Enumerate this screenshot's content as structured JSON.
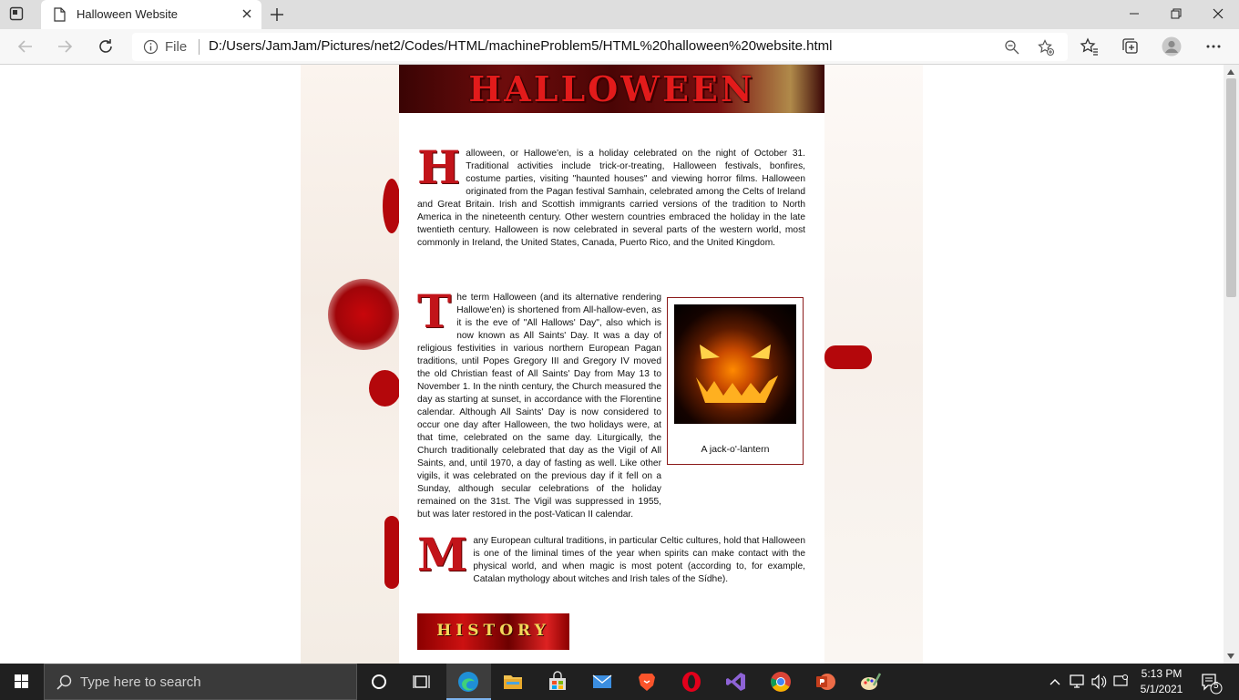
{
  "browser": {
    "tab_title": "Halloween Website",
    "address": {
      "scheme_label": "File",
      "url": "D:/Users/JamJam/Pictures/net2/Codes/HTML/machineProblem5/HTML%20halloween%20website.html"
    }
  },
  "page": {
    "banner_title": "HALLOWEEN",
    "para1": {
      "dropcap": "H",
      "text": "alloween, or Hallowe'en, is a holiday celebrated on the night of October 31. Traditional activities include trick-or-treating, Halloween festivals, bonfires, costume parties, visiting \"haunted houses\" and viewing horror films. Halloween originated from the Pagan festival Samhain, celebrated among the Celts of Ireland and Great Britain. Irish and Scottish immigrants carried versions of the tradition to North America in the nineteenth century. Other western countries embraced the holiday in the late twentieth century. Halloween is now celebrated in several parts of the western world, most commonly in Ireland, the United States, Canada, Puerto Rico, and the United Kingdom."
    },
    "para2": {
      "dropcap": "T",
      "text": "he term Halloween (and its alternative rendering Hallowe'en) is shortened from All-hallow-even, as it is the eve of \"All Hallows' Day\", also which is now known as All Saints' Day. It was a day of religious festivities in various northern European Pagan traditions, until Popes Gregory III and Gregory IV moved the old Christian feast of All Saints' Day from May 13 to November 1. In the ninth century, the Church measured the day as starting at sunset, in accordance with the Florentine calendar. Although All Saints' Day is now considered to occur one day after Halloween, the two holidays were, at that time, celebrated on the same day. Liturgically, the Church traditionally celebrated that day as the Vigil of All Saints, and, until 1970, a day of fasting as well. Like other vigils, it was celebrated on the previous day if it fell on a Sunday, although secular celebrations of the holiday remained on the 31st. The Vigil was suppressed in 1955, but was later restored in the post-Vatican II calendar."
    },
    "figure_caption": "A jack-o'-lantern",
    "para3": {
      "dropcap": "M",
      "text": "any European cultural traditions, in particular Celtic cultures, hold that Halloween is one of the liminal times of the year when spirits can make contact with the physical world, and when magic is most potent (according to, for example, Catalan mythology about witches and Irish tales of the Sídhe)."
    },
    "history_button": "HISTORY"
  },
  "taskbar": {
    "search_placeholder": "Type here to search",
    "time": "5:13 PM",
    "date": "5/1/2021",
    "notification_count": "5"
  },
  "colors": {
    "accent_red": "#c2141a",
    "taskbar": "#202020",
    "link_gold": "#f3d85a"
  }
}
